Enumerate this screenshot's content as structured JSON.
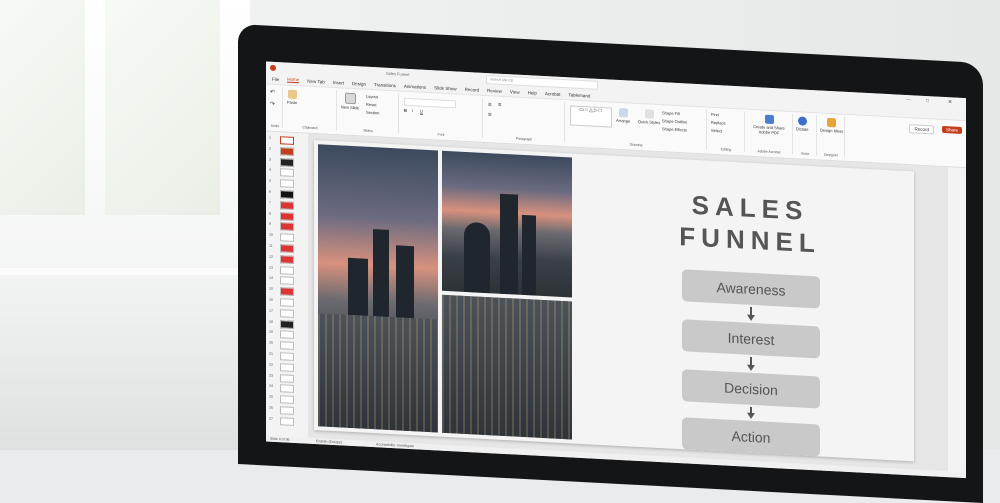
{
  "app": {
    "document_title": "Sales Funnel",
    "search_placeholder": "Search (Alt+Q)"
  },
  "menu_tabs": [
    "File",
    "Home",
    "New Tab",
    "Insert",
    "Design",
    "Transitions",
    "Animations",
    "Slide Show",
    "Record",
    "Review",
    "View",
    "Help",
    "Acrobat",
    "Tablemand"
  ],
  "active_tab": "Home",
  "ribbon": {
    "groups": [
      "Undo",
      "Clipboard",
      "Slides",
      "Font",
      "Paragraph",
      "Drawing",
      "Editing",
      "Adobe Acrobat",
      "Voice",
      "Designer"
    ],
    "buttons": {
      "paste": "Paste",
      "new_slide": "New Slide",
      "layout": "Layout",
      "reset": "Reset",
      "section": "Section",
      "arrange": "Arrange",
      "quick_styles": "Quick Styles",
      "shape_fill": "Shape Fill",
      "shape_outline": "Shape Outline",
      "shape_effects": "Shape Effects",
      "find": "Find",
      "replace": "Replace",
      "select": "Select",
      "create_share_pdf": "Create and Share Adobe PDF",
      "dictate": "Dictate",
      "design_ideas": "Design Ideas"
    },
    "record_label": "Record",
    "share_label": "Share"
  },
  "thumbnails": [
    "1",
    "2",
    "3",
    "4",
    "5",
    "6",
    "7",
    "8",
    "9",
    "10",
    "11",
    "12",
    "13",
    "14",
    "15",
    "16",
    "17",
    "18",
    "19",
    "20",
    "21",
    "22",
    "23",
    "24",
    "25",
    "26",
    "27"
  ],
  "slide": {
    "title_line1": "SALES",
    "title_line2": "FUNNEL",
    "steps": [
      "Awareness",
      "Interest",
      "Decision",
      "Action"
    ]
  },
  "status_bar": {
    "slide_count": "Slide 4 of 36",
    "language": "English (Europe)",
    "accessibility": "Accessibility: Investigate"
  },
  "colors": {
    "accent": "#c43e1c",
    "step_fill": "#c9c9c9",
    "step_text": "#555555",
    "monitor_bezel": "#141516"
  }
}
